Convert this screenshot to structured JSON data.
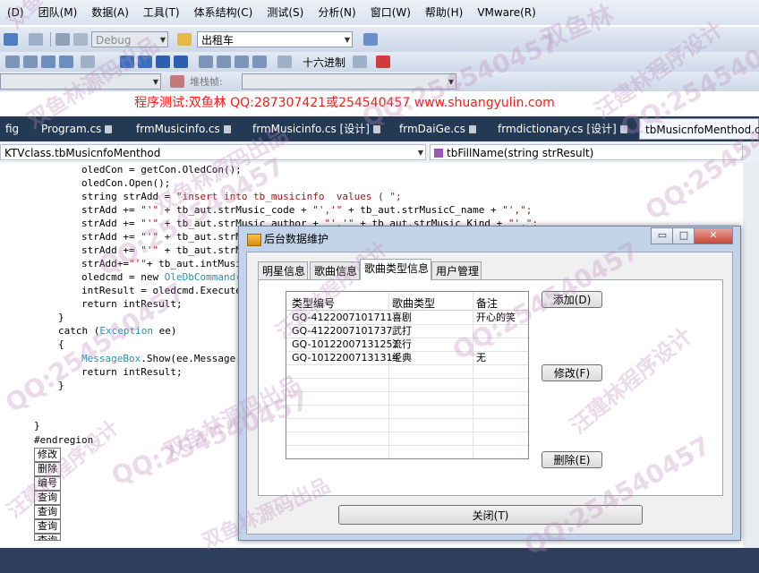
{
  "menu": [
    "(D)",
    "团队(M)",
    "数据(A)",
    "工具(T)",
    "体系结构(C)",
    "测试(S)",
    "分析(N)",
    "窗口(W)",
    "帮助(H)",
    "VMware(R)"
  ],
  "toolbar": {
    "config_value": "Debug",
    "search_value": "出租车",
    "hex_label": "十六进制",
    "stack_label": "堆栈帧:"
  },
  "banner": "程序测试:双鱼林 QQ:287307421或254540457 www.shuangyulin.com",
  "doc_tabs": [
    "fig",
    "Program.cs",
    "frmMusicinfo.cs",
    "frmMusicinfo.cs [设计]",
    "frmDaiGe.cs",
    "frmdictionary.cs [设计]",
    "tbMusicnfoMenthod.cs"
  ],
  "nav": {
    "left": "KTVclass.tbMusicnfoMenthod",
    "right": "tbFillName(string strResult)"
  },
  "code": {
    "l1": "oledCon = getCon.OledCon();",
    "l2": "oledCon.Open();",
    "l3a": "string strAdd = ",
    "l3b": "\"insert into tb_musicinfo  values ( \";",
    "l4a": "strAdd += ",
    "l4b": "\"'\"",
    "l4c": " + tb_aut.strMusic_code + ",
    "l4d": "\"','\"",
    "l4e": " + tb_aut.strMusicC_name + ",
    "l4f": "\"',\";",
    "l5a": "strAdd += ",
    "l5b": "\"'\"",
    "l5c": " + tb_aut.strMusic_author + ",
    "l5d": "\"','\"",
    "l5e": " + tb_aut.strMusic_Kind + ",
    "l5f": "\"',\";",
    "l6a": "strAdd += ",
    "l6b": "\"'\"",
    "l6c": " + tb_aut.strM",
    "l7a": "strAdd += ",
    "l7b": "\"'\"",
    "l7c": " + tb_aut.strM",
    "l8a": "strAdd+=",
    "l8b": "\"'\"",
    "l8c": "+ tb_aut.intMusi",
    "l9a": "oledcmd = new ",
    "l9b": "OleDbCommand",
    "l9c": "(",
    "l10": "intResult = oledcmd.Execute",
    "l11": "return intResult;",
    "l12": "}",
    "l13a": "catch (",
    "l13b": "Exception",
    "l13c": " ee)",
    "l14": "{",
    "l15a": "MessageBox",
    "l15b": ".Show(ee.Message.",
    "l16": "return intResult;",
    "l17": "}",
    "l18": "}",
    "l19": "#endregion"
  },
  "designer_buttons": [
    "修改",
    "删除",
    "编号",
    "查询",
    "查询",
    "查询",
    "查询"
  ],
  "dialog": {
    "title": "后台数据维护",
    "tabs": [
      "明星信息",
      "歌曲信息",
      "歌曲类型信息",
      "用户管理"
    ],
    "active_tab": "歌曲类型信息",
    "grid": {
      "columns": [
        "类型编号",
        "歌曲类型",
        "备注"
      ],
      "rows": [
        [
          "GQ-4122007101711",
          "喜剧",
          "开心的笑"
        ],
        [
          "GQ-4122007101737",
          "武打",
          ""
        ],
        [
          "GQ-10122007131251",
          "流行",
          ""
        ],
        [
          "GQ-10122007131314",
          "经典",
          "无"
        ]
      ]
    },
    "buttons": {
      "add": "添加(D)",
      "modify": "修改(F)",
      "delete": "删除(E)",
      "close": "关闭(T)"
    }
  },
  "watermarks": {
    "w1": "双鱼林",
    "w2": "汪建林程序设计",
    "w3": "双鱼林源码出品",
    "w4": "QQ:254540457",
    "w5": "QQ:254540457",
    "w6": "双鱼林源码出品",
    "w7": "双鱼林源码出品",
    "w8": "QQ:254540457",
    "w9": "QQ:254540457",
    "w10": "汪建林程序设计",
    "w11": "汪建林程序设计",
    "w12": "双鱼林源码出品",
    "w13": "QQ:254540457",
    "w14": "QQ:254540457",
    "w15": "汪建林程序设计",
    "w16": "QQ:254540457",
    "w17": "双鱼林程序设计",
    "w18": "QQ:254540457"
  },
  "colors": {
    "banner": "#ff1a1a",
    "tab_bar": "#243954",
    "string": "#a31515",
    "keyword": "#0000ff",
    "type": "#2b91af",
    "watermark": "#be8cbe"
  }
}
